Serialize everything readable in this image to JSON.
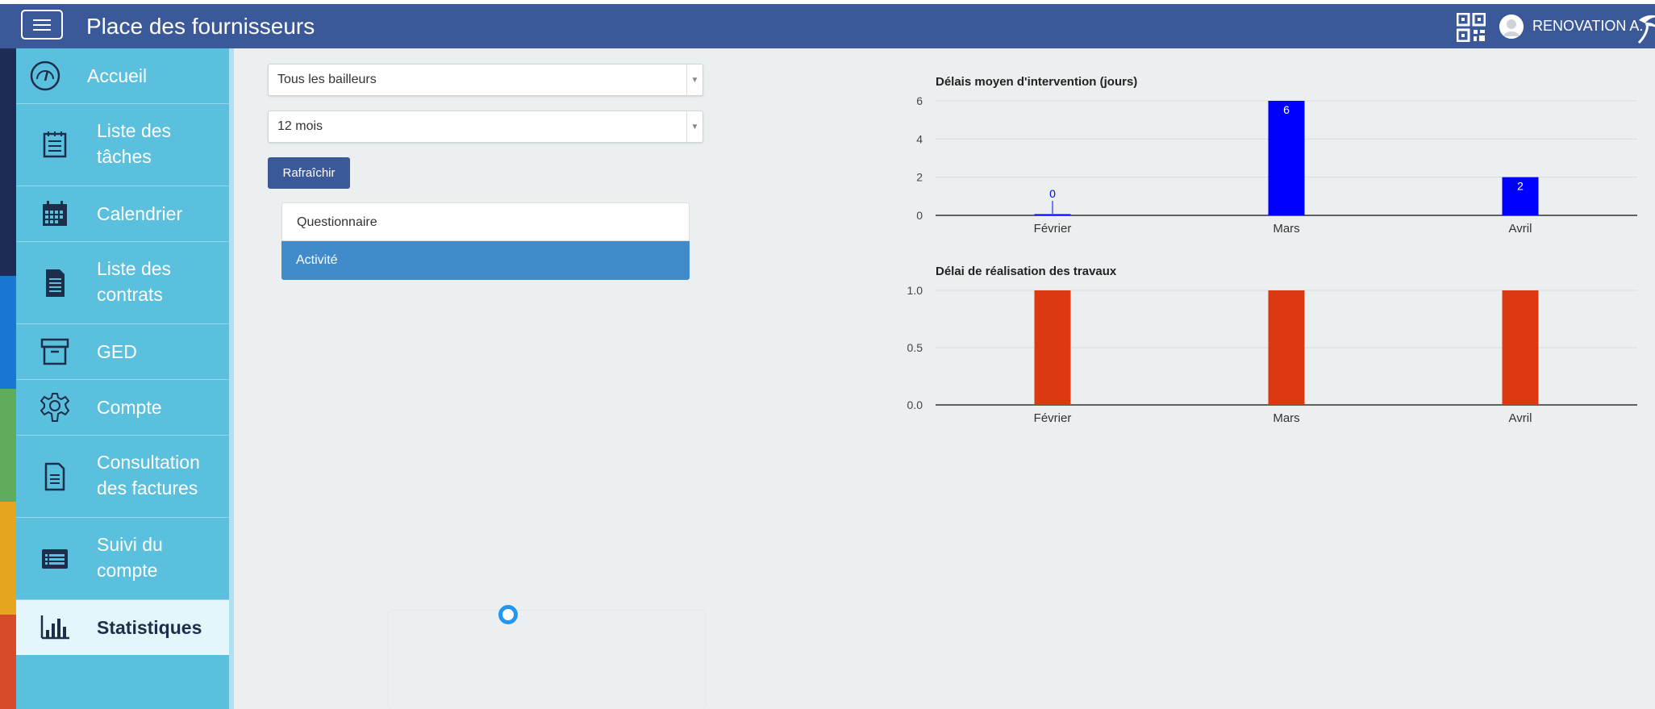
{
  "header": {
    "menu_icon": "hamburger-icon",
    "title": "Place des fournisseurs",
    "qr_icon": "qr-code-icon",
    "user_name": "RENOVATION A.",
    "logo_icon": "palm-logo-icon"
  },
  "colors": {
    "header": "#3b5998",
    "sidebar": "#5bc0de",
    "active_item": "#e4f6fb",
    "tab_active": "#428bca",
    "chart1_bar": "#0000ff",
    "chart2_bar": "#dc3912"
  },
  "sidebar": {
    "items": [
      {
        "label": "Accueil",
        "icon": "speedometer-icon"
      },
      {
        "label": "Liste des tâches",
        "icon": "clipboard-list-icon"
      },
      {
        "label": "Calendrier",
        "icon": "calendar-icon"
      },
      {
        "label": "Liste des contrats",
        "icon": "document-icon"
      },
      {
        "label": "GED",
        "icon": "archive-box-icon"
      },
      {
        "label": "Compte",
        "icon": "gear-icon"
      },
      {
        "label": "Consultation des factures",
        "icon": "file-text-icon"
      },
      {
        "label": "Suivi du compte",
        "icon": "list-window-icon"
      },
      {
        "label": "Statistiques",
        "icon": "bar-chart-icon",
        "active": true
      }
    ]
  },
  "filters": {
    "bailleur": "Tous les bailleurs",
    "period": "12 mois",
    "refresh_label": "Rafraîchir"
  },
  "tabs": [
    {
      "label": "Questionnaire",
      "active": false
    },
    {
      "label": "Activité",
      "active": true
    }
  ],
  "chart_data": [
    {
      "type": "bar",
      "title": "Délais moyen d'intervention (jours)",
      "categories": [
        "Février",
        "Mars",
        "Avril"
      ],
      "values": [
        0,
        6,
        2
      ],
      "data_labels": [
        "0",
        "6",
        "2"
      ],
      "y_ticks": [
        "0",
        "2",
        "4",
        "6"
      ],
      "ylim": [
        0,
        6
      ],
      "grid": true,
      "color": "#0000ff"
    },
    {
      "type": "bar",
      "title": "Délai de réalisation des travaux",
      "categories": [
        "Février",
        "Mars",
        "Avril"
      ],
      "values": [
        1,
        1,
        1
      ],
      "y_ticks": [
        "0.0",
        "0.5",
        "1.0"
      ],
      "ylim": [
        0,
        1
      ],
      "grid": true,
      "color": "#dc3912"
    }
  ]
}
